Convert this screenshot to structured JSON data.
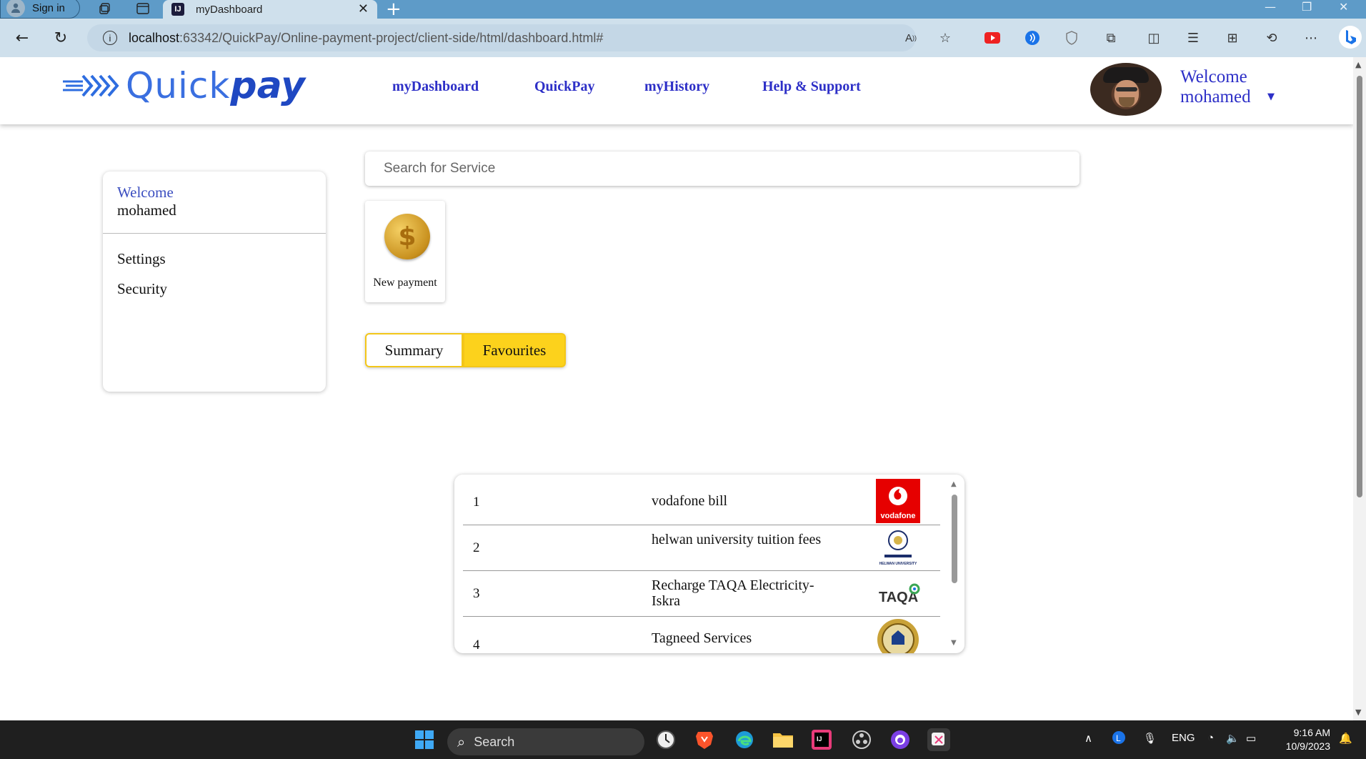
{
  "browser": {
    "signin_label": "Sign in",
    "tab_title": "myDashboard",
    "url_host": "localhost",
    "url_path": ":63342/QuickPay/Online-payment-project/client-side/html/dashboard.html#"
  },
  "header": {
    "logo_quick": "Quick",
    "logo_pay": "pay",
    "nav": [
      "myDashboard",
      "QuickPay",
      "myHistory",
      "Help & Support"
    ],
    "welcome_label": "Welcome",
    "user_name": "mohamed"
  },
  "sidebar": {
    "welcome_label": "Welcome",
    "user_name": "mohamed",
    "items": [
      "Settings",
      "Security"
    ]
  },
  "search": {
    "placeholder": "Search for Service"
  },
  "services": [
    {
      "label": "New payment",
      "icon": "dollar-coin-icon"
    }
  ],
  "tabs": {
    "summary": "Summary",
    "favourites": "Favourites",
    "active": "favourites"
  },
  "favourites": [
    {
      "num": "1",
      "name": "vodafone bill",
      "logo": "vodafone-logo"
    },
    {
      "num": "2",
      "name": "helwan university tuition fees",
      "logo": "helwan-university-logo"
    },
    {
      "num": "3",
      "name": "Recharge TAQA Electricity-Iskra",
      "logo": "taqa-logo"
    },
    {
      "num": "4",
      "name": "Tagneed Services",
      "logo": "tagneed-logo"
    }
  ],
  "taskbar": {
    "search_label": "Search",
    "lang": "ENG",
    "time": "9:16 AM",
    "date": "10/9/2023"
  },
  "colors": {
    "brand_blue": "#2d2fc7",
    "accent_yellow": "#fcd21c",
    "browser_frame": "#5e9bc8"
  }
}
